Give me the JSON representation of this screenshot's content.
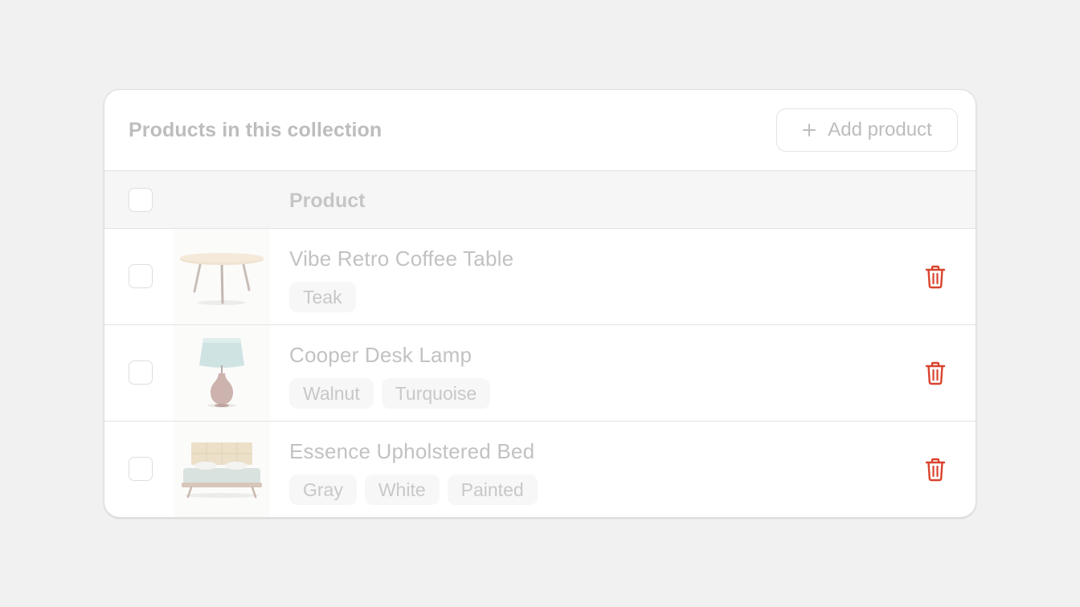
{
  "collection": {
    "title": "Products in this collection",
    "add_button_label": "Add product"
  },
  "table": {
    "column_header": "Product"
  },
  "products": [
    {
      "name": "Vibe Retro Coffee Table",
      "tags": [
        "Teak"
      ],
      "image_icon": "coffee-table"
    },
    {
      "name": "Cooper Desk Lamp",
      "tags": [
        "Walnut",
        "Turquoise"
      ],
      "image_icon": "desk-lamp"
    },
    {
      "name": "Essence Upholstered Bed",
      "tags": [
        "Gray",
        "White",
        "Painted"
      ],
      "image_icon": "bed"
    }
  ],
  "colors": {
    "delete": "#d9432e",
    "muted_text": "#bdbdbd",
    "background": "#f1f1f1"
  }
}
